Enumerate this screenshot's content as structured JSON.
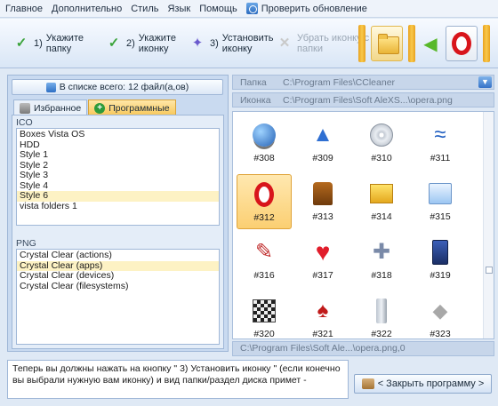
{
  "menu": {
    "items": [
      "Главное",
      "Дополнительно",
      "Стиль",
      "Язык",
      "Помощь"
    ],
    "update": "Проверить обновление"
  },
  "toolbar": {
    "steps": [
      {
        "num": "1)",
        "label": "Укажите папку",
        "icon": "check-icon"
      },
      {
        "num": "2)",
        "label": "Укажите иконку",
        "icon": "check-icon"
      },
      {
        "num": "3)",
        "label": "Установить иконку",
        "icon": "wand-icon"
      },
      {
        "num": "",
        "label": "Убрать иконку с папки",
        "icon": "x-icon"
      }
    ]
  },
  "left": {
    "count_label": "В списке всего: 12 файл(а,ов)",
    "tabs": [
      "Избранное",
      "Программные"
    ],
    "ico_label": "ICO",
    "ico_items": [
      "Boxes Vista OS",
      "HDD",
      "Style 1",
      "Style 2",
      "Style 3",
      "Style 4",
      "Style 6",
      "vista folders 1"
    ],
    "ico_selected": "Style 6",
    "png_label": "PNG",
    "png_items": [
      "Crystal Clear (actions)",
      "Crystal Clear (apps)",
      "Crystal Clear (devices)",
      "Crystal Clear (filesystems)"
    ],
    "png_selected": "Crystal Clear (apps)"
  },
  "right": {
    "folder_label": "Папка",
    "folder_value": "C:\\Program Files\\CCleaner",
    "icon_label": "Иконка",
    "icon_value": "C:\\Program Files\\Soft AleXS...\\opera.png",
    "icons": [
      {
        "id": "#308",
        "glyph": "globe-icon"
      },
      {
        "id": "#309",
        "glyph": "chart-icon"
      },
      {
        "id": "#310",
        "glyph": "cd-icon"
      },
      {
        "id": "#311",
        "glyph": "stroke-icon"
      },
      {
        "id": "#312",
        "glyph": "opera-icon"
      },
      {
        "id": "#313",
        "glyph": "vest-icon"
      },
      {
        "id": "#314",
        "glyph": "box-icon"
      },
      {
        "id": "#315",
        "glyph": "window-icon"
      },
      {
        "id": "#316",
        "glyph": "pen-icon"
      },
      {
        "id": "#317",
        "glyph": "heart-icon"
      },
      {
        "id": "#318",
        "glyph": "gamepad-icon"
      },
      {
        "id": "#319",
        "glyph": "arcade-icon"
      },
      {
        "id": "#320",
        "glyph": "chess-icon"
      },
      {
        "id": "#321",
        "glyph": "cards-icon"
      },
      {
        "id": "#322",
        "glyph": "usb-icon"
      },
      {
        "id": "#323",
        "glyph": "lamp-icon"
      }
    ],
    "selected_icon": "#312",
    "bottom_path": "C:\\Program Files\\Soft Ale...\\opera.png,0"
  },
  "hint": "Теперь вы должны нажать на кнопку \" 3)  Установить иконку \" (если конечно вы выбрали нужную вам иконку) и вид папки/раздел диска примет -",
  "close_button": "< Закрыть программу >"
}
